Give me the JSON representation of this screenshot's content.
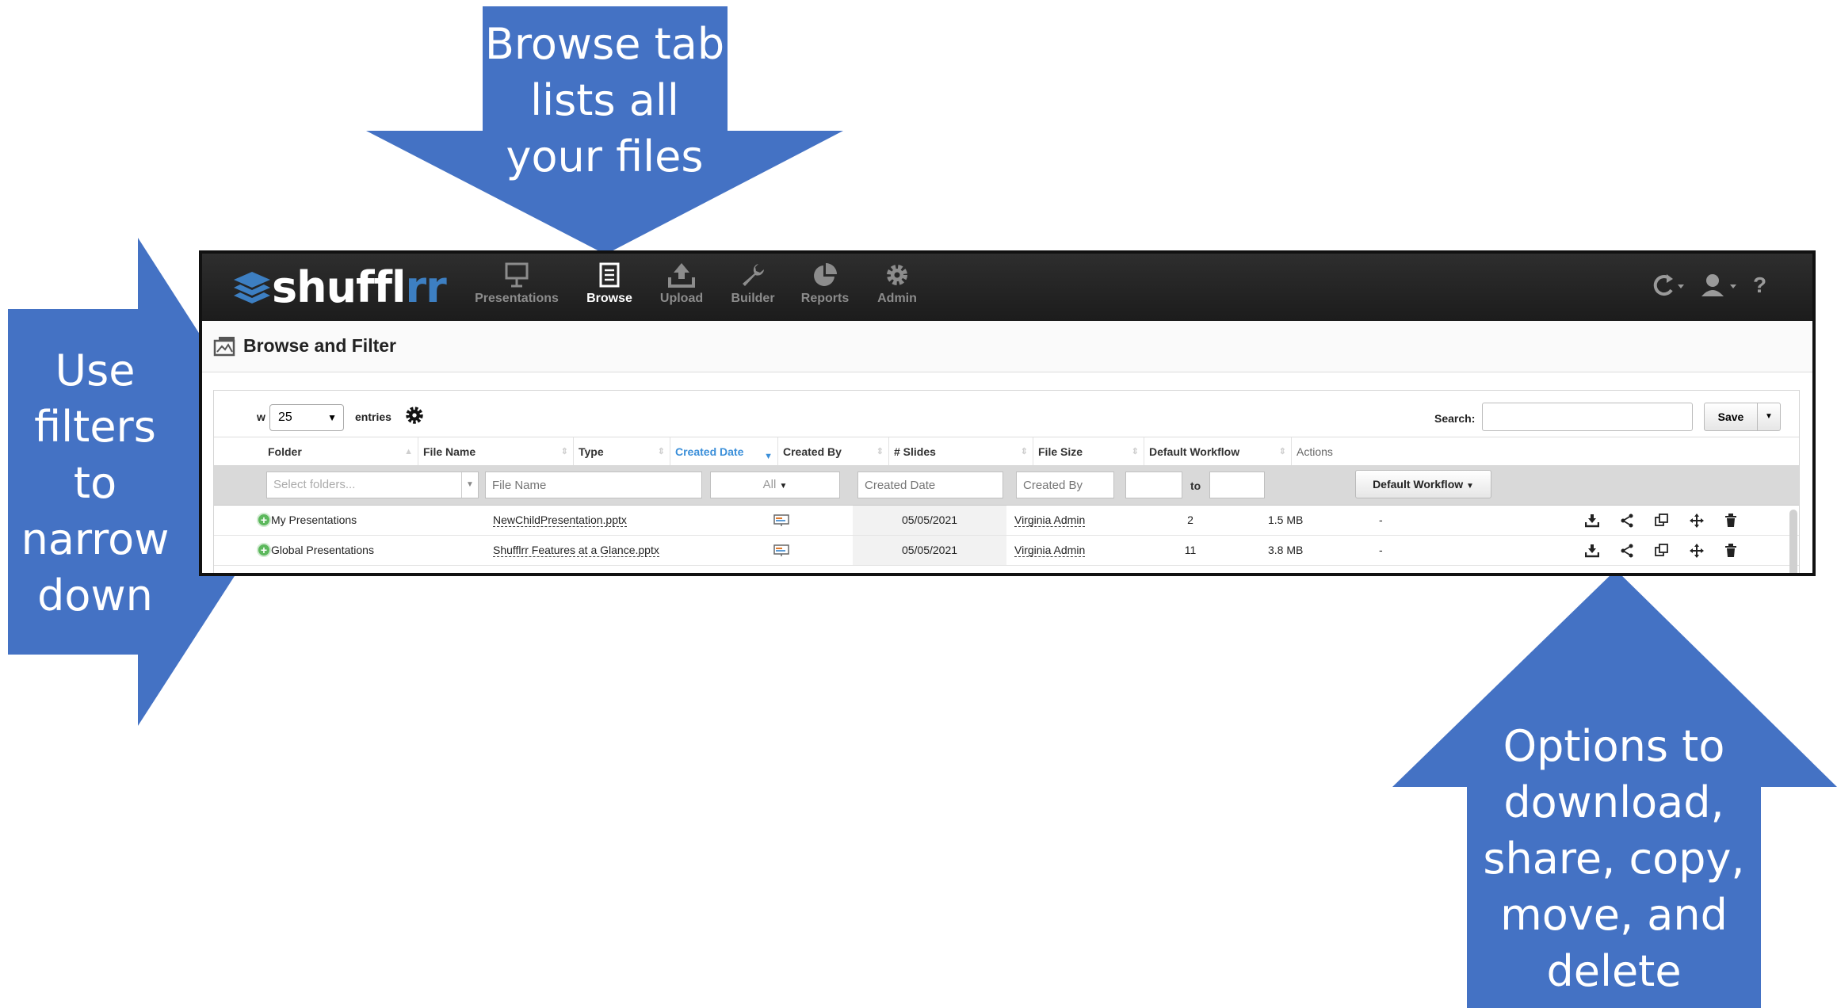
{
  "callouts": {
    "top": "Browse tab\nlists all\nyour files",
    "left": "Use\nfilters\nto\nnarrow\ndown",
    "bottom_right": "Options to\ndownload,\nshare, copy,\nmove, and\ndelete"
  },
  "colors": {
    "callout_blue": "#4472c4",
    "navbar": "#232323",
    "accent": "#3d7fc2",
    "sorted_header": "#3b8fd9"
  },
  "app": {
    "logo": {
      "main": "shuffl",
      "accent": "rr"
    },
    "nav": [
      {
        "label": "Presentations",
        "icon": "presentation-icon"
      },
      {
        "label": "Browse",
        "icon": "browse-icon",
        "active": true
      },
      {
        "label": "Upload",
        "icon": "upload-icon"
      },
      {
        "label": "Builder",
        "icon": "wrench-icon"
      },
      {
        "label": "Reports",
        "icon": "pie-chart-icon"
      },
      {
        "label": "Admin",
        "icon": "gear-icon"
      }
    ],
    "nav_right": {
      "sync_icon": "sync-icon",
      "user_icon": "user-icon",
      "help": "?"
    },
    "page_title": "Browse and Filter",
    "toolbar": {
      "show_label": "w",
      "entries_value": "25",
      "entries_label": "entries",
      "search_label": "Search:",
      "search_value": "",
      "save_label": "Save"
    },
    "table": {
      "headers": [
        "Folder",
        "File Name",
        "Type",
        "Created Date",
        "Created By",
        "# Slides",
        "File Size",
        "Default Workflow",
        "Actions"
      ],
      "sorted_column": "Created Date",
      "filters": {
        "folder_placeholder": "Select folders...",
        "filename_placeholder": "File Name",
        "type_value": "All",
        "created_date_placeholder": "Created Date",
        "created_by_placeholder": "Created By",
        "slides_to": "to",
        "workflow_value": "Default Workflow"
      },
      "rows": [
        {
          "folder": "My Presentations",
          "file_name": "NewChildPresentation.pptx",
          "type_icon": "presentation-file-icon",
          "created_date": "05/05/2021",
          "created_by": "Virginia Admin",
          "slides": "2",
          "file_size": "1.5 MB",
          "workflow": "-"
        },
        {
          "folder": "Global Presentations",
          "file_name": "Shufflrr Features at a Glance.pptx",
          "type_icon": "presentation-file-icon",
          "created_date": "05/05/2021",
          "created_by": "Virginia Admin",
          "slides": "11",
          "file_size": "3.8 MB",
          "workflow": "-"
        }
      ],
      "actions": [
        "download-icon",
        "share-icon",
        "copy-icon",
        "move-icon",
        "delete-icon"
      ]
    }
  }
}
